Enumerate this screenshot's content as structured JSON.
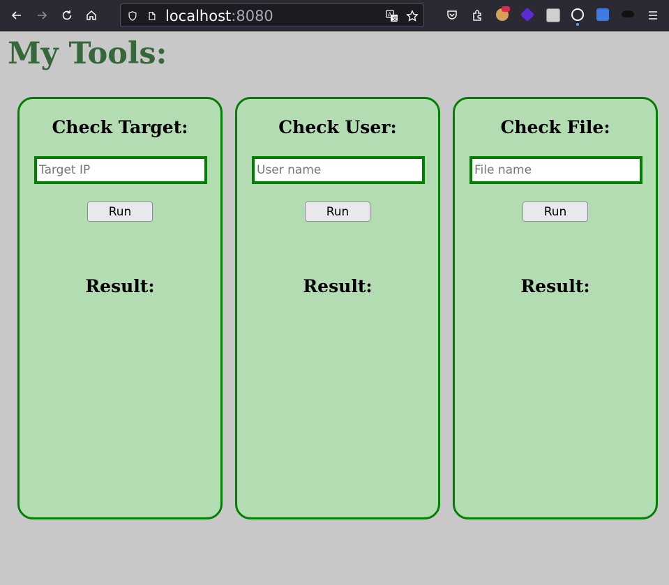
{
  "browser": {
    "url_host": "localhost",
    "url_port": ":8080",
    "icons": [
      "back-icon",
      "forward-icon",
      "reload-icon",
      "home-icon",
      "shield-icon",
      "page-icon",
      "translate-icon",
      "bookmark-star-icon",
      "pocket-icon",
      "extensions-icon",
      "menu-icon"
    ]
  },
  "page": {
    "title": "My Tools:"
  },
  "cards": [
    {
      "title": "Check Target:",
      "placeholder": "Target IP",
      "button": "Run",
      "result": "Result:"
    },
    {
      "title": "Check User:",
      "placeholder": "User name",
      "button": "Run",
      "result": "Result:"
    },
    {
      "title": "Check File:",
      "placeholder": "File name",
      "button": "Run",
      "result": "Result:"
    }
  ],
  "colors": {
    "page_bg": "#c8c8c8",
    "title": "#36673a",
    "card_bg": "#b3dcb3",
    "card_border": "#008000"
  }
}
